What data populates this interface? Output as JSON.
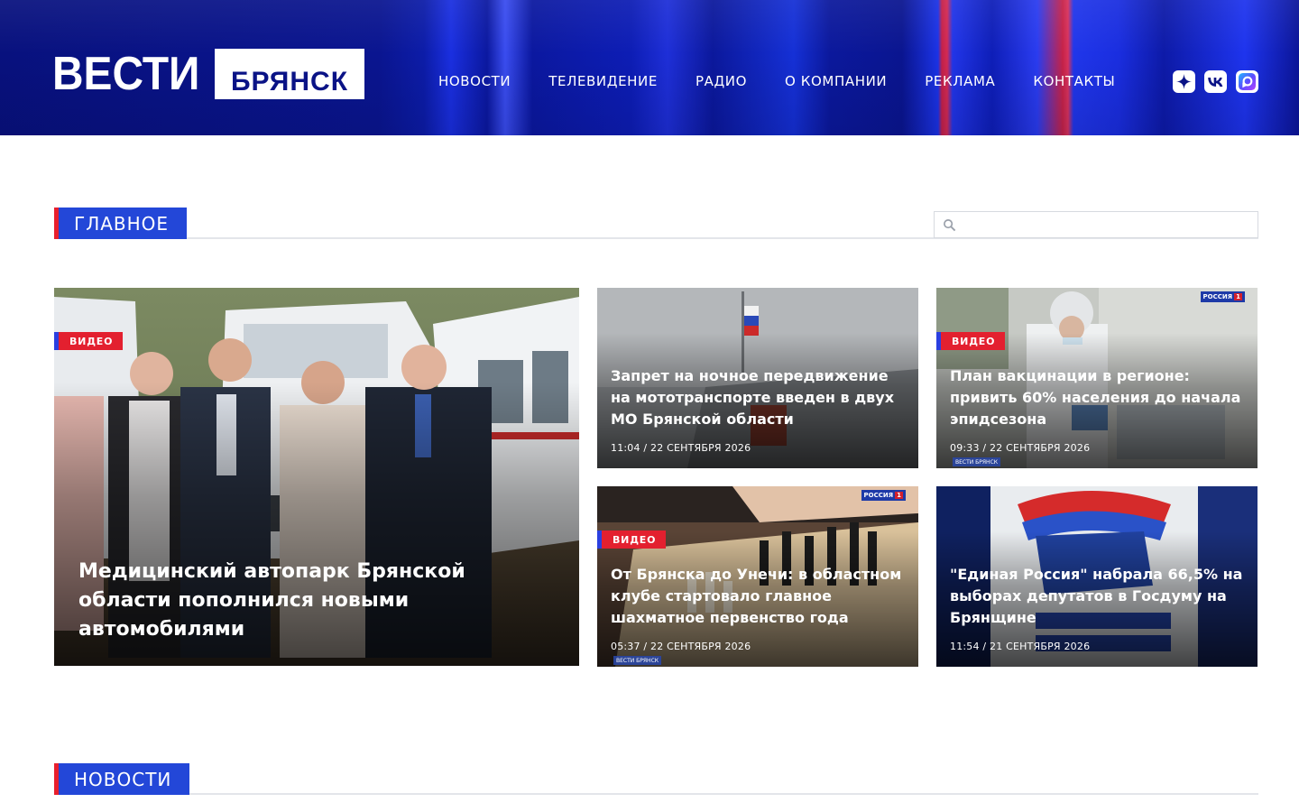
{
  "header": {
    "logo_main": "ВЕСТИ",
    "logo_city": "БРЯНСК",
    "nav": [
      "НОВОСТИ",
      "ТЕЛЕВИДЕНИЕ",
      "РАДИО",
      "О КОМПАНИИ",
      "РЕКЛАМА",
      "КОНТАКТЫ"
    ],
    "social": [
      "dzen-icon",
      "vk-icon",
      "max-messenger-icon"
    ]
  },
  "main_section": {
    "title": "ГЛАВНОЕ",
    "search_placeholder": ""
  },
  "featured": {
    "badge": "ВИДЕО",
    "title": "Медицинский автопарк Брянской области пополнился новыми автомобилями"
  },
  "cards": [
    {
      "badge": "",
      "title": "Запрет на ночное передвижение на мототранспорте введен в двух МО Брянской области",
      "date": "11:04 / 22 СЕНТЯБРЯ 2026"
    },
    {
      "badge": "ВИДЕО",
      "title": "План вакцинации в регионе: привить 60% населения до начала эпидсезона",
      "date": "09:33 / 22 СЕНТЯБРЯ 2026"
    },
    {
      "badge": "ВИДЕО",
      "title": "От Брянска до Унечи: в областном клубе стартовало главное шахматное первенство года",
      "date": "05:37 / 22 СЕНТЯБРЯ 2026"
    },
    {
      "badge": "",
      "title": "\"Единая Россия\" набрала 66,5% на выборах депутатов в Госдуму на Брянщине",
      "date": "11:54 / 21 СЕНТЯБРЯ 2026"
    }
  ],
  "news_section": {
    "title": "НОВОСТИ"
  },
  "colors": {
    "header_bg": "#0a1386",
    "accent_blue": "#2347d8",
    "accent_red": "#e3202f"
  }
}
